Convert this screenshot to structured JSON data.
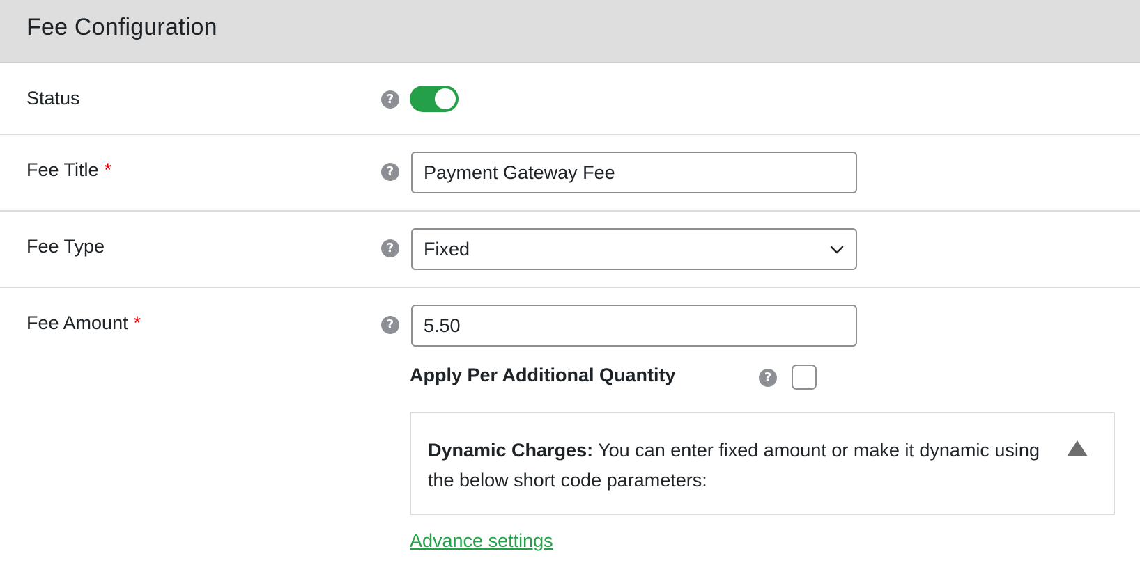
{
  "header": {
    "title": "Fee Configuration"
  },
  "fields": {
    "status": {
      "label": "Status",
      "enabled": true
    },
    "fee_title": {
      "label": "Fee Title",
      "required_mark": "*",
      "value": "Payment Gateway Fee"
    },
    "fee_type": {
      "label": "Fee Type",
      "selected": "Fixed"
    },
    "fee_amount": {
      "label": "Fee Amount",
      "required_mark": "*",
      "value": "5.50"
    },
    "apply_per_qty": {
      "label": "Apply Per Additional Quantity",
      "checked": false
    }
  },
  "dynamic_charges": {
    "title": "Dynamic Charges:",
    "text": "You can enter fixed amount or make it dynamic using the below short code parameters:"
  },
  "advance_settings": {
    "label": "Advance settings"
  },
  "help_glyph": "?",
  "colors": {
    "accent": "#24a148",
    "required": "#e00000",
    "header_bg": "#dedede",
    "help_icon": "#8c8f94"
  }
}
